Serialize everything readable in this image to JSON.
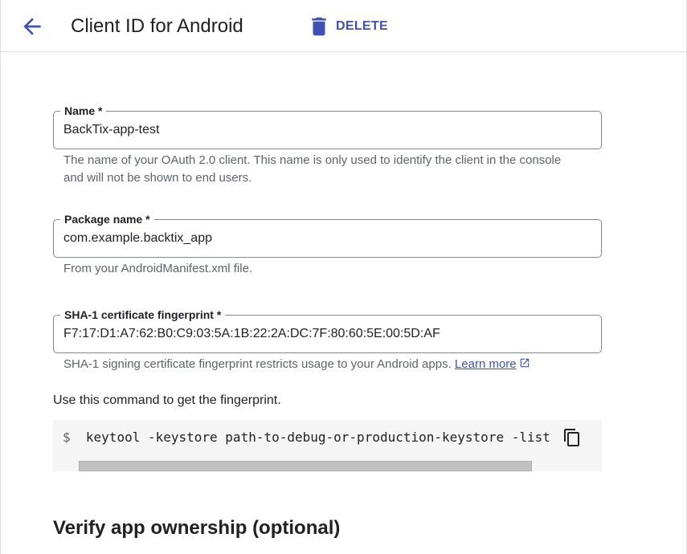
{
  "header": {
    "back_icon": "arrow-back-icon",
    "title": "Client ID for Android",
    "delete_icon": "trash-icon",
    "delete_label": "DELETE",
    "accent_color": "#3f51b5"
  },
  "form": {
    "name": {
      "label": "Name *",
      "value": "BackTix-app-test",
      "hint": "The name of your OAuth 2.0 client. This name is only used to identify the client in the console and will not be shown to end users."
    },
    "package": {
      "label": "Package name *",
      "value": "com.example.backtix_app",
      "hint": "From your AndroidManifest.xml file."
    },
    "sha1": {
      "label": "SHA-1 certificate fingerprint *",
      "value": "F7:17:D1:A7:62:B0:C9:03:5A:1B:22:2A:DC:7F:80:60:5E:00:5D:AF",
      "hint": "SHA-1 signing certificate fingerprint restricts usage to your Android apps.",
      "learn_more": "Learn more",
      "external_icon": "open-in-new-icon"
    }
  },
  "command": {
    "instruction": "Use this command to get the fingerprint.",
    "prompt": "$",
    "text": "keytool -keystore path-to-debug-or-production-keystore -list",
    "copy_icon": "copy-icon"
  },
  "section": {
    "title": "Verify app ownership (optional)"
  }
}
